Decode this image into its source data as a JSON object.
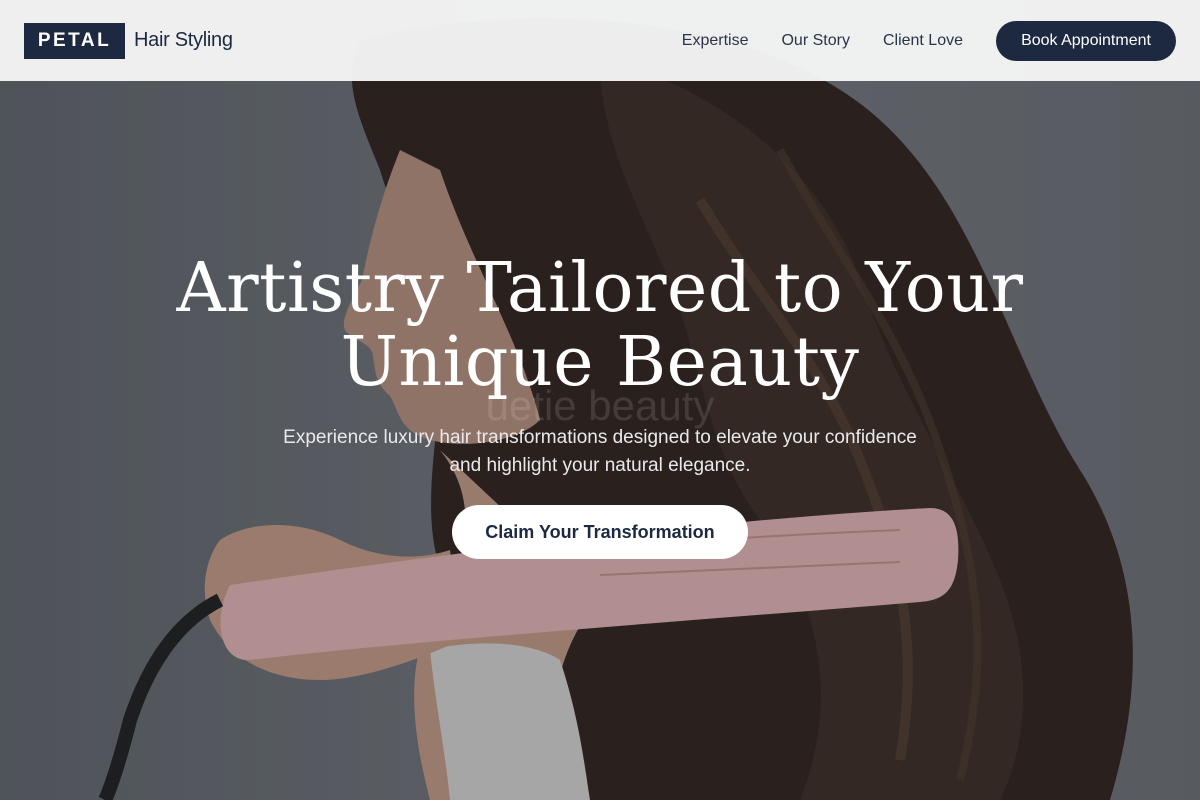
{
  "brand": {
    "logo_mark": "PETAL",
    "logo_text": "Hair Styling"
  },
  "nav": {
    "links": [
      "Expertise",
      "Our Story",
      "Client Love"
    ],
    "cta_label": "Book Appointment"
  },
  "hero": {
    "title_line_1": "Artistry Tailored to Your",
    "title_line_2": "Unique Beauty",
    "ghost_text": "uetie beauty",
    "subtitle_line_1": "Experience luxury hair transformations designed to elevate your confidence",
    "subtitle_line_2": "and highlight your natural elegance.",
    "cta_label": "Claim Your Transformation"
  },
  "colors": {
    "navy": "#1c2940",
    "white": "#ffffff",
    "header_bg": "#f6f6f6",
    "iron_pink": "#e7b5b3"
  },
  "image": {
    "subject": "woman with long wavy dark hair holding a pink hair styling iron"
  }
}
